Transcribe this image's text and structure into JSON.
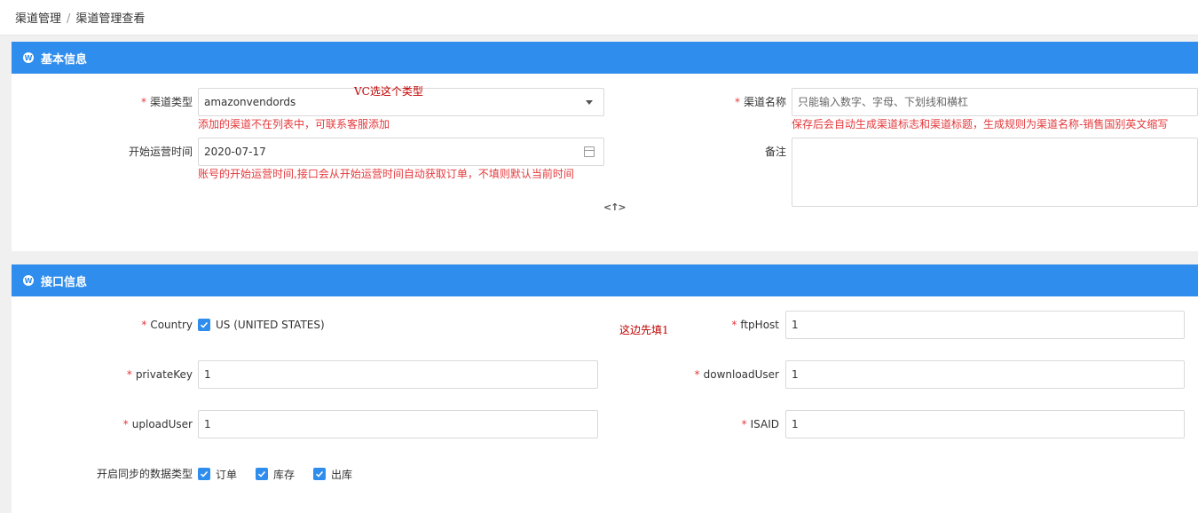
{
  "breadcrumb": {
    "root": "渠道管理",
    "separator": "/",
    "current": "渠道管理查看"
  },
  "basic": {
    "title": "基本信息",
    "channel_type": {
      "label": "渠道类型",
      "value": "amazonvendords",
      "hint": "添加的渠道不在列表中，可联系客服添加"
    },
    "channel_name": {
      "label": "渠道名称",
      "placeholder": "只能输入数字、字母、下划线和横杠",
      "hint": "保存后会自动生成渠道标志和渠道标题，生成规则为渠道名称-销售国别英文缩写"
    },
    "start_time": {
      "label": "开始运营时间",
      "value": "2020-07-17",
      "hint": "账号的开始运营时间,接口会从开始运营时间自动获取订单，不填则默认当前时间"
    },
    "remark": {
      "label": "备注",
      "value": ""
    },
    "annotation": "VC选这个类型",
    "collapse_symbol": "<↑>"
  },
  "api": {
    "title": "接口信息",
    "annotation": "这边先填1",
    "country": {
      "label": "Country",
      "option": "US (UNITED STATES)"
    },
    "ftp_host": {
      "label": "ftpHost",
      "value": "1"
    },
    "private_key": {
      "label": "privateKey",
      "value": "1"
    },
    "download_user": {
      "label": "downloadUser",
      "value": "1"
    },
    "upload_user": {
      "label": "uploadUser",
      "value": "1"
    },
    "isaid": {
      "label": "ISAID",
      "value": "1"
    },
    "sync_types": {
      "label": "开启同步的数据类型",
      "options": [
        "订单",
        "库存",
        "出库"
      ]
    }
  },
  "colors": {
    "primary": "#2f8ded",
    "required": "#e4393c",
    "annotation": "#c00000"
  },
  "icons": {
    "panel": "wordpress-icon",
    "select": "caret-down-icon",
    "date": "calendar-icon",
    "checkbox": "check-icon"
  }
}
